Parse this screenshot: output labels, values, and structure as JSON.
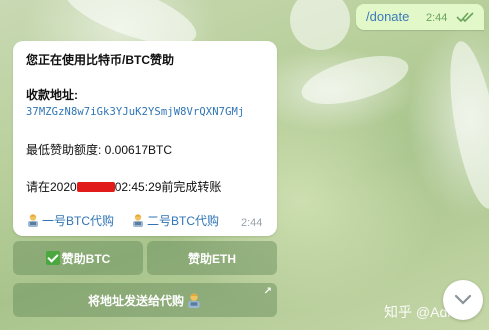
{
  "outgoing": {
    "text": "/donate",
    "time": "2:44",
    "status": "read"
  },
  "message": {
    "title": "您正在使用比特币/BTC赞助",
    "address_label": "收款地址:",
    "address": "37MZGzN8w7iGk3YJuK2YSmjW8VrQXN7GMj",
    "min_amount": "最低赞助额度: 0.00617BTC",
    "deadline_prefix": "请在2020",
    "deadline_suffix": "02:45:29前完成转账",
    "link1": "一号BTC代购",
    "link2": "二号BTC代购",
    "time": "2:44"
  },
  "keyboard": {
    "btn_btc": "赞助BTC",
    "btn_eth": "赞助ETH",
    "btn_send": "将地址发送给代购",
    "corner_icon": "↗"
  },
  "watermark": "知乎 @Admin",
  "colors": {
    "link": "#2f74b5",
    "redaction": "#e11a1a",
    "outgoing_bg": "#e3f8c8",
    "check": "#4aa83f"
  }
}
